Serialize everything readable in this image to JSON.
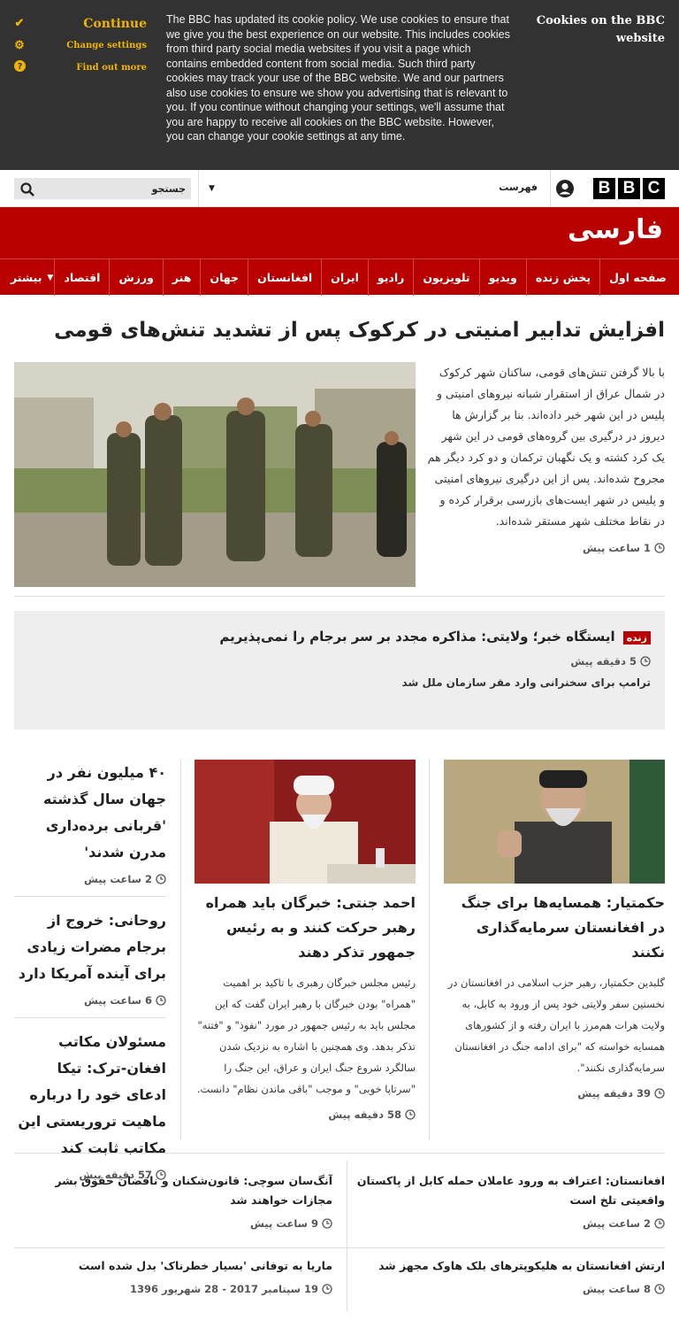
{
  "cookie_banner": {
    "title": "Cookies on the BBC website",
    "text": "The BBC has updated its cookie policy. We use cookies to ensure that we give you the best experience on our website. This includes cookies from third party social media websites if you visit a page which contains embedded content from social media. Such third party cookies may track your use of the BBC website. We and our partners also use cookies to ensure we show you advertising that is relevant to you. If you continue without changing your settings, we'll assume that you are happy to receive all cookies on the BBC website. However, you can change your cookie settings at any time.",
    "actions": [
      {
        "label": "Continue",
        "icon": "check-icon"
      },
      {
        "label": "Change settings",
        "icon": "gear-icon"
      },
      {
        "label": "Find out more",
        "icon": "question-icon"
      }
    ]
  },
  "topbar": {
    "search_placeholder": "جستجو",
    "menu_label": "فهرست",
    "logo_letters": [
      "B",
      "B",
      "C"
    ]
  },
  "brand": {
    "title": "فارسی"
  },
  "nav": {
    "items": [
      "صفحه اول",
      "پخش زنده",
      "ویدیو",
      "تلویزیون",
      "رادیو",
      "ایران",
      "افغانستان",
      "جهان",
      "هنر",
      "ورزش",
      "اقتصاد"
    ],
    "more": "بیشتر"
  },
  "lead": {
    "headline": "افزایش تدابیر امنیتی در کرکوک پس از تشدید تنش‌های قومی",
    "summary": "با بالا گرفتن تنش‌های قومی، ساکنان شهر کرکوک در شمال عراق از استقرار شبانه نیروهای امنیتی و پلیس در این شهر خبر داده‌اند. بنا بر گزارش ها دیروز در درگیری بین گروه‌های قومی در این شهر یک کرد کشته و یک نگهبان ترکمان و دو کرد دیگر هم مجروح شده‌اند. پس از این درگیری نیروهای امنیتی و پلیس در شهر ایست‌های بازرسی برقرار کرده و در نقاط مختلف شهر مستقر شده‌اند.",
    "time": "1 ساعت پیش"
  },
  "live": {
    "badge": "زنده",
    "headline": "ایستگاه خبر؛ ولایتی: مذاکره مجدد بر سر برجام را نمی‌پذیریم",
    "time": "5 دقیقه پیش",
    "sub": "ترامپ برای سخنرانی وارد مقر سازمان ملل شد"
  },
  "stories": {
    "right": {
      "title": "حکمتیار: همسایه‌ها برای جنگ در افغانستان سرمایه‌گذاری نکنند",
      "summary": "گلبدین حکمتیار، رهبر حزب اسلامی در افغانستان در نخستین سفر ولایتی خود پس از ورود به کابل، به ولایت هرات هم‌مرز با ایران رفته و از کشورهای همسایه خواسته که \"برای ادامه جنگ در افغانستان سرمایه‌گذاری نکنند\".",
      "time": "39 دقیقه پیش"
    },
    "mid": {
      "title": "احمد جنتی: خبرگان باید همراه رهبر حرکت کنند و به رئیس جمهور تذکر دهند",
      "summary": "رئیس مجلس خبرگان رهبری با تاکید بر اهمیت \"همراه\" بودن خبرگان با رهبر ایران گفت که این مجلس باید به رئیس جمهور در مورد \"نفوذ\" و \"فتنه\" تذکر بدهد. وی همچنین با اشاره به نزدیک شدن سالگرد شروع جنگ ایران و عراق، این جنگ را \"سرتاپا خوبی\" و موجب \"باقی ماندن نظام\" دانست.",
      "time": "58 دقیقه پیش"
    },
    "left": [
      {
        "title": "۴۰ میلیون نفر در جهان سال گذشته 'قربانی برده‌داری مدرن شدند'",
        "time": "2 ساعت پیش"
      },
      {
        "title": "روحانی: خروج از برجام مضرات زیادی برای آینده آمریکا دارد",
        "time": "6 ساعت پیش"
      },
      {
        "title": "مسئولان مکاتب افغان-ترک: تیکا ادعای خود را درباره ماهیت تروریستی این مکاتب ثابت کند",
        "time": "57 دقیقه پیش"
      }
    ]
  },
  "bottom": [
    {
      "title": "افغانستان: اعتراف به ورود عاملان حمله کابل از پاکستان واقعیتی تلخ است",
      "time": "2 ساعت پیش"
    },
    {
      "title": "آنگ‌سان سوچی: قانون‌شکنان و ناقضان حقوق بشر مجازات خواهند شد",
      "time": "9 ساعت پیش"
    },
    {
      "title": "ارتش افغانستان به هلیکوپترهای بلک هاوک مجهز شد",
      "time": "8 ساعت پیش"
    },
    {
      "title": "ماریا به توفانی 'بسیار خطرناک' بدل شده است",
      "time": "19 سپتامبر 2017 - 28 شهریور 1396"
    }
  ]
}
